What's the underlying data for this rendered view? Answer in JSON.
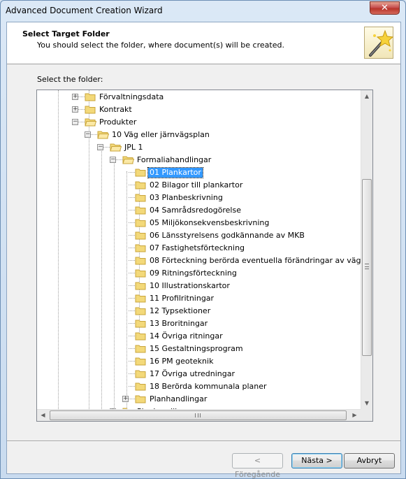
{
  "window": {
    "title": "Advanced Document Creation Wizard",
    "close_glyph": "✕"
  },
  "header": {
    "title": "Select Target Folder",
    "description": "You should select the folder, where document(s) will be created."
  },
  "folder_label": "Select the folder:",
  "tree": [
    {
      "label": "Förvaltningsdata",
      "level": 0,
      "expander": "+"
    },
    {
      "label": "Kontrakt",
      "level": 0,
      "expander": "+"
    },
    {
      "label": "Produkter",
      "level": 0,
      "expander": "-"
    },
    {
      "label": "10 Väg eller järnvägsplan",
      "level": 1,
      "expander": "-"
    },
    {
      "label": "JPL 1",
      "level": 2,
      "expander": "-"
    },
    {
      "label": "Formaliahandlingar",
      "level": 3,
      "expander": "-"
    },
    {
      "label": "01 Plankartor",
      "level": 4,
      "expander": "",
      "selected": true
    },
    {
      "label": "02 Bilagor till plankartor",
      "level": 4,
      "expander": ""
    },
    {
      "label": "03 Planbeskrivning",
      "level": 4,
      "expander": ""
    },
    {
      "label": "04 Samrådsredogörelse",
      "level": 4,
      "expander": ""
    },
    {
      "label": "05 Miljökonsekvensbeskrivning",
      "level": 4,
      "expander": ""
    },
    {
      "label": "06 Länsstyrelsens godkännande av MKB",
      "level": 4,
      "expander": ""
    },
    {
      "label": "07 Fastighetsförteckning",
      "level": 4,
      "expander": ""
    },
    {
      "label": "08 Förteckning berörda  eventuella förändringar av väg",
      "level": 4,
      "expander": ""
    },
    {
      "label": "09 Ritningsförteckning",
      "level": 4,
      "expander": ""
    },
    {
      "label": "10 Illustrationskartor",
      "level": 4,
      "expander": ""
    },
    {
      "label": "11 Profilritningar",
      "level": 4,
      "expander": ""
    },
    {
      "label": "12 Typsektioner",
      "level": 4,
      "expander": ""
    },
    {
      "label": "13 Broritningar",
      "level": 4,
      "expander": ""
    },
    {
      "label": "14 Övriga ritningar",
      "level": 4,
      "expander": ""
    },
    {
      "label": "15 Gestaltningsprogram",
      "level": 4,
      "expander": ""
    },
    {
      "label": "16 PM geoteknik",
      "level": 4,
      "expander": ""
    },
    {
      "label": "17 Övriga utredningar",
      "level": 4,
      "expander": ""
    },
    {
      "label": "18 Berörda kommunala planer",
      "level": 4,
      "expander": ""
    },
    {
      "label": "Planhandlingar",
      "level": 4,
      "expander": "+"
    },
    {
      "label": "Planhandlingar",
      "level": 3,
      "expander": "+"
    }
  ],
  "buttons": {
    "back": "< Föregående",
    "next": "Nästa >",
    "cancel": "Avbryt"
  },
  "colors": {
    "selection": "#3399ff",
    "folder": "#f3d97a",
    "folder_edge": "#c9a53b"
  }
}
